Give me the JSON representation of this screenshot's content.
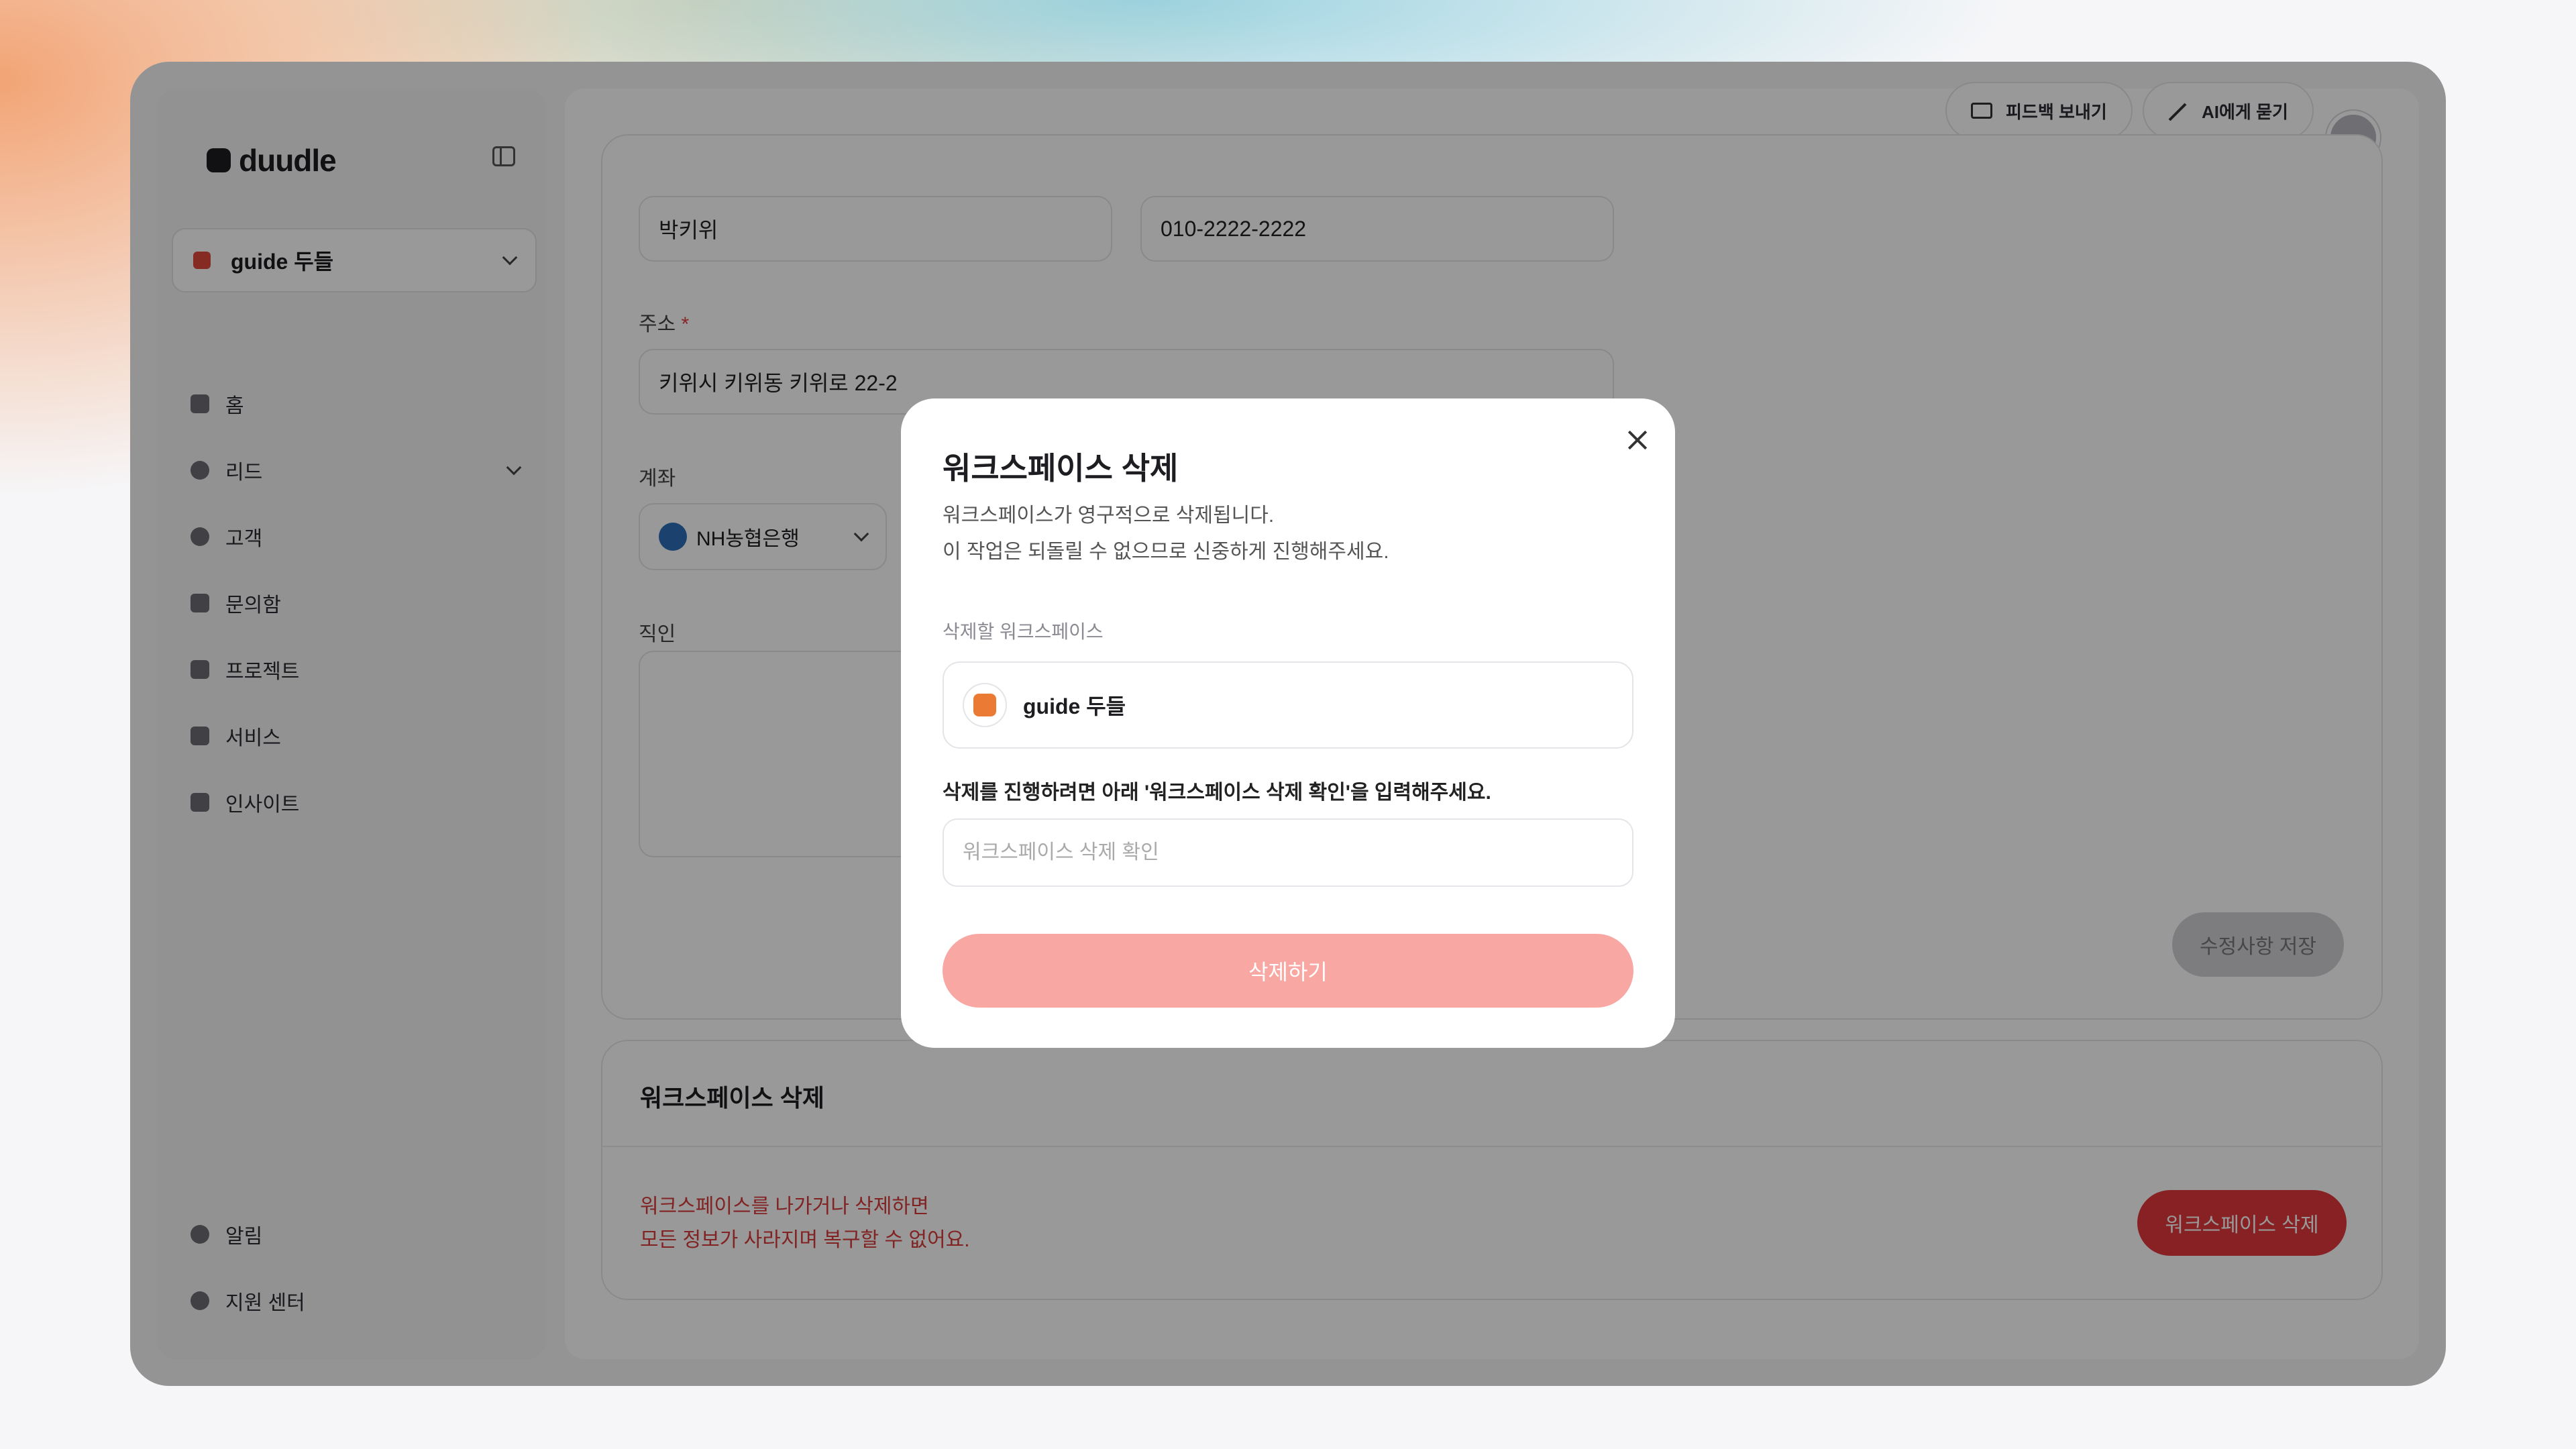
{
  "app": {
    "logo_text": "duudle",
    "workspace_select": "guide 두들"
  },
  "sidebar": {
    "items": [
      {
        "label": "홈",
        "icon": "home-icon"
      },
      {
        "label": "리드",
        "icon": "lead-icon"
      },
      {
        "label": "고객",
        "icon": "user-icon"
      },
      {
        "label": "문의함",
        "icon": "inbox-icon"
      },
      {
        "label": "프로젝트",
        "icon": "folder-icon"
      },
      {
        "label": "서비스",
        "icon": "briefcase-icon"
      },
      {
        "label": "인사이트",
        "icon": "chart-icon"
      }
    ],
    "bottom_items": [
      {
        "label": "알림",
        "icon": "bell-icon"
      },
      {
        "label": "지원 센터",
        "icon": "help-icon"
      }
    ]
  },
  "topbar": {
    "feedback_label": "피드백 보내기",
    "ask_ai_label": "AI에게 묻기"
  },
  "form": {
    "name_value": "박키위",
    "phone_value": "010-2222-2222",
    "address_label": "주소",
    "address_required": "*",
    "address_value": "키위시 키위동 키위로 22-2",
    "account_label": "계좌",
    "bank_value": "NH농협은행",
    "seal_label": "직인",
    "save_label": "수정사항 저장"
  },
  "delete_section": {
    "title": "워크스페이스 삭제",
    "warning_line1": "워크스페이스를 나가거나 삭제하면",
    "warning_line2": "모든 정보가 사라지며 복구할 수 없어요.",
    "button_label": "워크스페이스 삭제"
  },
  "modal": {
    "title": "워크스페이스 삭제",
    "desc_line1": "워크스페이스가 영구적으로 삭제됩니다.",
    "desc_line2": "이 작업은 되돌릴 수 없으므로 신중하게 진행해주세요.",
    "section_label": "삭제할 워크스페이스",
    "workspace_name": "guide 두들",
    "instruction": "삭제를 진행하려면 아래 '워크스페이스 삭제 확인'을 입력해주세요.",
    "input_placeholder": "워크스페이스 삭제 확인",
    "input_value": "",
    "submit_label": "삭제하기"
  },
  "colors": {
    "danger": "#e2383d",
    "danger_disabled": "#f8a7a3",
    "workspace_icon": "#ea7a34"
  }
}
